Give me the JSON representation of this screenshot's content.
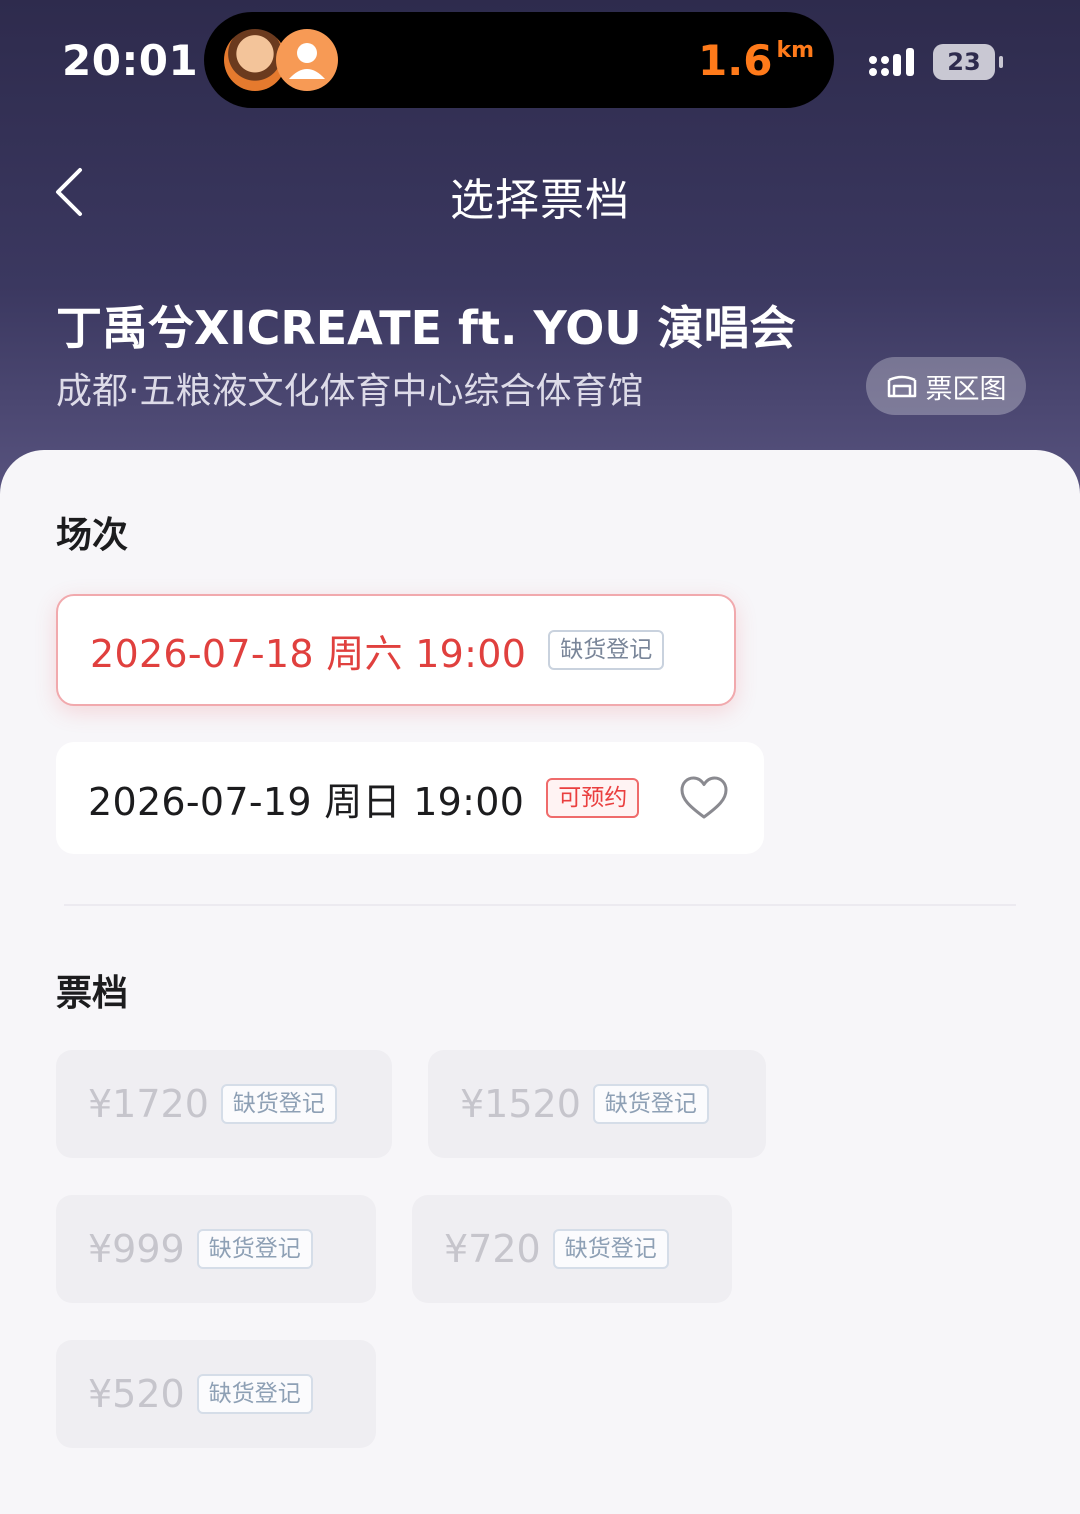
{
  "status_bar": {
    "time": "20:01",
    "distance_value": "1.6",
    "distance_unit": "km",
    "battery": "23"
  },
  "nav": {
    "title": "选择票档"
  },
  "event": {
    "title": "丁禹兮XICREATE ft. YOU 演唱会",
    "venue": "成都·五粮液文化体育中心综合体育馆",
    "map_button": "票区图"
  },
  "sessions_section": {
    "title": "场次",
    "items": [
      {
        "date": "2026-07-18 周六 19:00",
        "tag": "缺货登记",
        "selected": true
      },
      {
        "date": "2026-07-19 周日 19:00",
        "tag": "可预约",
        "selected": false
      }
    ]
  },
  "tiers_section": {
    "title": "票档",
    "items": [
      {
        "price": "¥1720",
        "tag": "缺货登记"
      },
      {
        "price": "¥1520",
        "tag": "缺货登记"
      },
      {
        "price": "¥999",
        "tag": "缺货登记"
      },
      {
        "price": "¥720",
        "tag": "缺货登记"
      },
      {
        "price": "¥520",
        "tag": "缺货登记"
      }
    ]
  },
  "colors": {
    "header_bg": "#2e2b4d",
    "accent_red": "#e0403e",
    "distance_orange": "#ff7a1a"
  }
}
